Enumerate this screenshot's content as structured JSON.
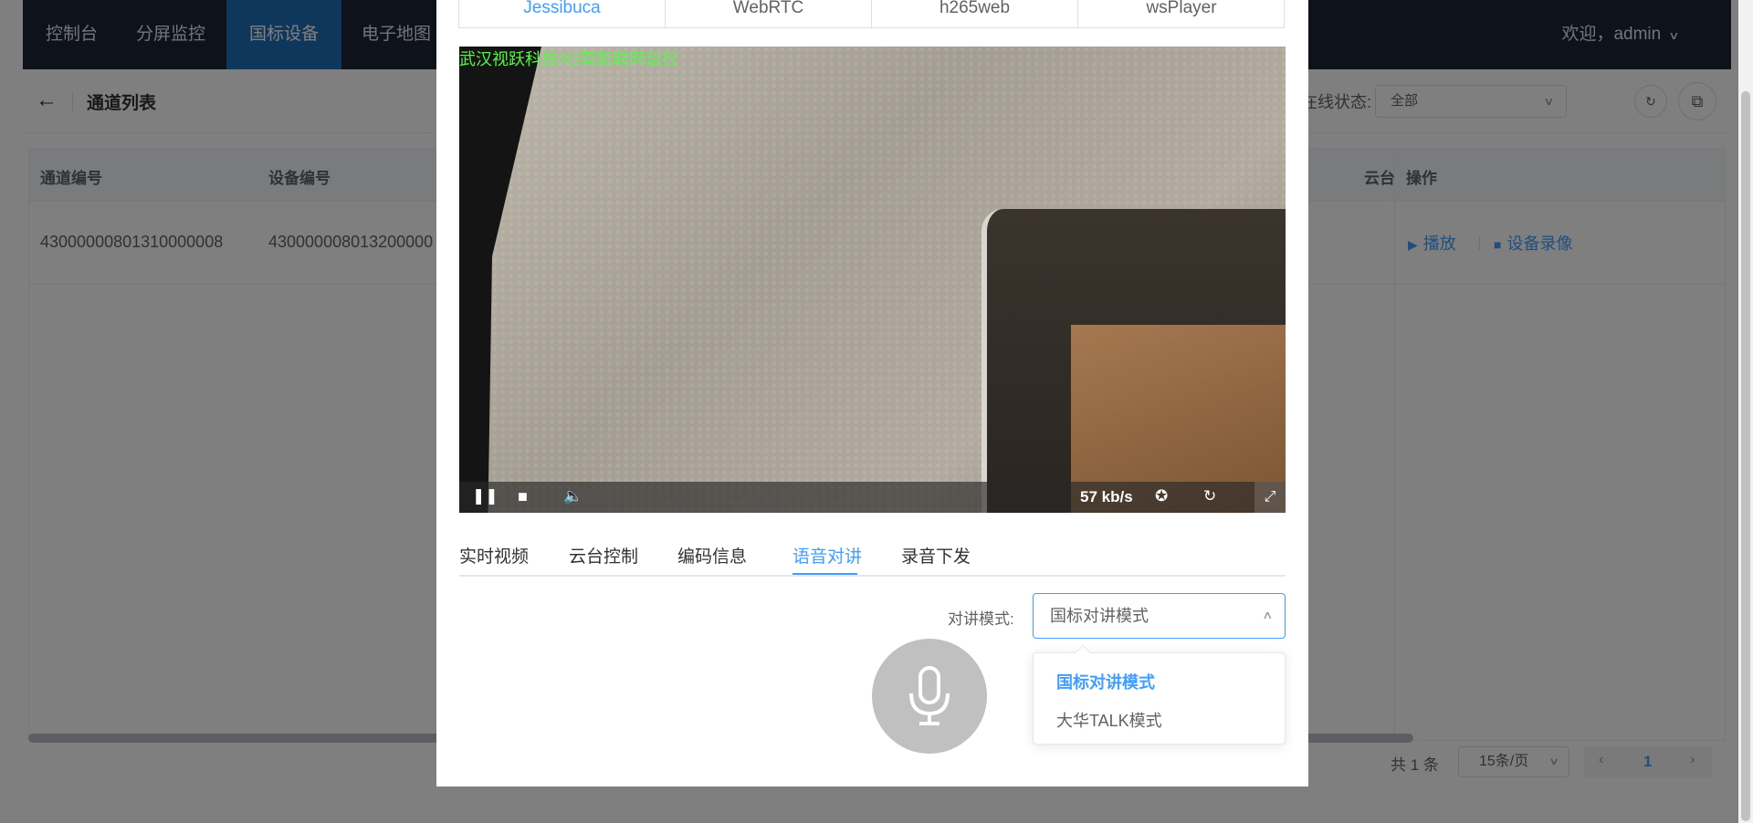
{
  "topnav": {
    "items": [
      "控制台",
      "分屏监控",
      "国标设备",
      "电子地图"
    ],
    "active_index": 2,
    "user": "欢迎，admin"
  },
  "page": {
    "title": "通道列表",
    "status_label": "在线状态:",
    "status_value": "全部"
  },
  "table": {
    "headers": [
      "通道编号",
      "设备编号",
      "云台",
      "操作"
    ],
    "rows": [
      {
        "channel_id": "43000000801310000008",
        "device_id": "430000008013200000"
      }
    ],
    "actions": [
      "播放",
      "设备录像"
    ]
  },
  "pagination": {
    "total": "共 1 条",
    "page_size": "15条/页",
    "current": "1"
  },
  "dialog": {
    "player_tabs": [
      "Jessibuca",
      "WebRTC",
      "h265web",
      "wsPlayer"
    ],
    "player_tab_active": 0,
    "osd_text": "武汉视跃科技4G智能联网监控",
    "speed": "57 kb/s",
    "function_tabs": [
      "实时视频",
      "云台控制",
      "编码信息",
      "语音对讲",
      "录音下发"
    ],
    "function_tab_active": 3,
    "talk_label": "对讲模式:",
    "talk_value": "国标对讲模式",
    "talk_options": [
      "国标对讲模式",
      "大华TALK模式"
    ],
    "talk_option_selected": 0
  },
  "colors": {
    "nav_bg": "#1b2537",
    "nav_active": "#1f6fb8",
    "accent": "#409eff",
    "osd": "#59f54a"
  }
}
